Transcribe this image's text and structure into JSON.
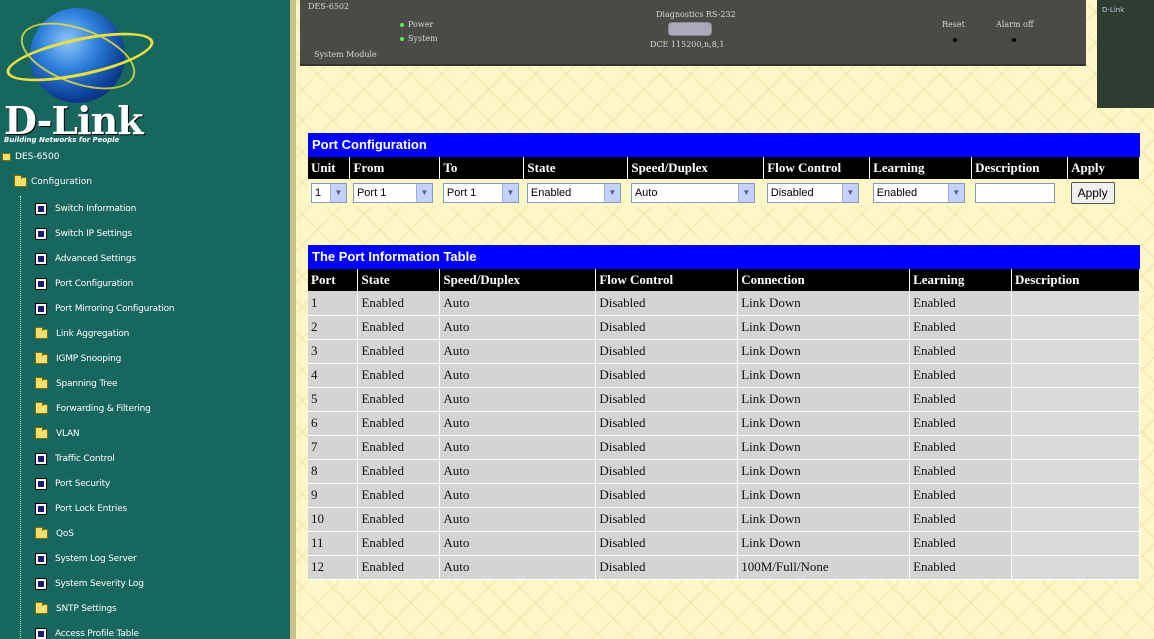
{
  "sidebar": {
    "logo_text": "D-Link",
    "tagline": "Building Networks for People",
    "device": "DES-6500",
    "configuration": "Configuration",
    "items": [
      {
        "label": "Switch Information",
        "icon": "page"
      },
      {
        "label": "Switch IP Settings",
        "icon": "page"
      },
      {
        "label": "Advanced Settings",
        "icon": "page"
      },
      {
        "label": "Port Configuration",
        "icon": "page"
      },
      {
        "label": "Port Mirroring Configuration",
        "icon": "page"
      },
      {
        "label": "Link Aggregation",
        "icon": "folder"
      },
      {
        "label": "IGMP Snooping",
        "icon": "folder"
      },
      {
        "label": "Spanning Tree",
        "icon": "folder"
      },
      {
        "label": "Forwarding & Filtering",
        "icon": "folder"
      },
      {
        "label": "VLAN",
        "icon": "folder"
      },
      {
        "label": "Traffic Control",
        "icon": "page"
      },
      {
        "label": "Port Security",
        "icon": "page"
      },
      {
        "label": "Port Lock Entries",
        "icon": "page"
      },
      {
        "label": "QoS",
        "icon": "folder"
      },
      {
        "label": "System Log Server",
        "icon": "page"
      },
      {
        "label": "System Severity Log",
        "icon": "page"
      },
      {
        "label": "SNTP Settings",
        "icon": "folder"
      },
      {
        "label": "Access Profile Table",
        "icon": "page"
      }
    ]
  },
  "device_panel": {
    "model": "DES-6502",
    "power": "Power",
    "system": "System",
    "module": "System Module",
    "diag": "Diagnostics RS-232",
    "dce": "DCE 115200,n,8,1",
    "reset": "Reset",
    "alarm": "Alarm off",
    "brand_small": "D-Link"
  },
  "port_config": {
    "title": "Port Configuration",
    "headers": [
      "Unit",
      "From",
      "To",
      "State",
      "Speed/Duplex",
      "Flow Control",
      "Learning",
      "Description",
      "Apply"
    ],
    "unit": "1",
    "from": "Port 1",
    "to": "Port 1",
    "state": "Enabled",
    "speed": "Auto",
    "flow": "Disabled",
    "learning": "Enabled",
    "description": "",
    "apply_label": "Apply"
  },
  "port_info": {
    "title": "The Port Information Table",
    "headers": [
      "Port",
      "State",
      "Speed/Duplex",
      "Flow Control",
      "Connection",
      "Learning",
      "Description"
    ],
    "rows": [
      [
        "1",
        "Enabled",
        "Auto",
        "Disabled",
        "Link Down",
        "Enabled",
        ""
      ],
      [
        "2",
        "Enabled",
        "Auto",
        "Disabled",
        "Link Down",
        "Enabled",
        ""
      ],
      [
        "3",
        "Enabled",
        "Auto",
        "Disabled",
        "Link Down",
        "Enabled",
        ""
      ],
      [
        "4",
        "Enabled",
        "Auto",
        "Disabled",
        "Link Down",
        "Enabled",
        ""
      ],
      [
        "5",
        "Enabled",
        "Auto",
        "Disabled",
        "Link Down",
        "Enabled",
        ""
      ],
      [
        "6",
        "Enabled",
        "Auto",
        "Disabled",
        "Link Down",
        "Enabled",
        ""
      ],
      [
        "7",
        "Enabled",
        "Auto",
        "Disabled",
        "Link Down",
        "Enabled",
        ""
      ],
      [
        "8",
        "Enabled",
        "Auto",
        "Disabled",
        "Link Down",
        "Enabled",
        ""
      ],
      [
        "9",
        "Enabled",
        "Auto",
        "Disabled",
        "Link Down",
        "Enabled",
        ""
      ],
      [
        "10",
        "Enabled",
        "Auto",
        "Disabled",
        "Link Down",
        "Enabled",
        ""
      ],
      [
        "11",
        "Enabled",
        "Auto",
        "Disabled",
        "Link Down",
        "Enabled",
        ""
      ],
      [
        "12",
        "Enabled",
        "Auto",
        "Disabled",
        "100M/Full/None",
        "Enabled",
        ""
      ]
    ]
  }
}
